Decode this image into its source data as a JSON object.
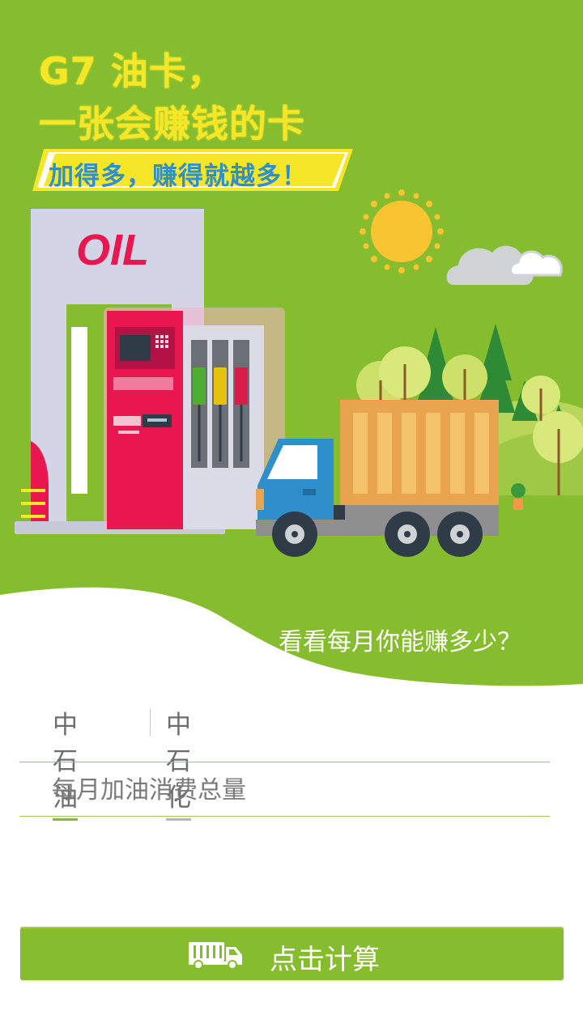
{
  "hero": {
    "title_line1": "G7 油卡，",
    "title_line2": "一张会赚钱的卡",
    "slogan": "加得多，赚得就越多！",
    "sign_text": "OIL",
    "question": "看看每月你能赚多少？"
  },
  "tabs": [
    {
      "label": "中石油",
      "selected": true
    },
    {
      "label": "中石化",
      "selected": false
    }
  ],
  "form": {
    "consumption_placeholder": "每月加油消费总量"
  },
  "button": {
    "label": "点击计算",
    "icon": "truck-icon"
  },
  "colors": {
    "hero_green": "#86bd2f",
    "title_yellow": "#f5e627",
    "slogan_blue": "#2e8fcf",
    "oil_red": "#e8174f"
  }
}
